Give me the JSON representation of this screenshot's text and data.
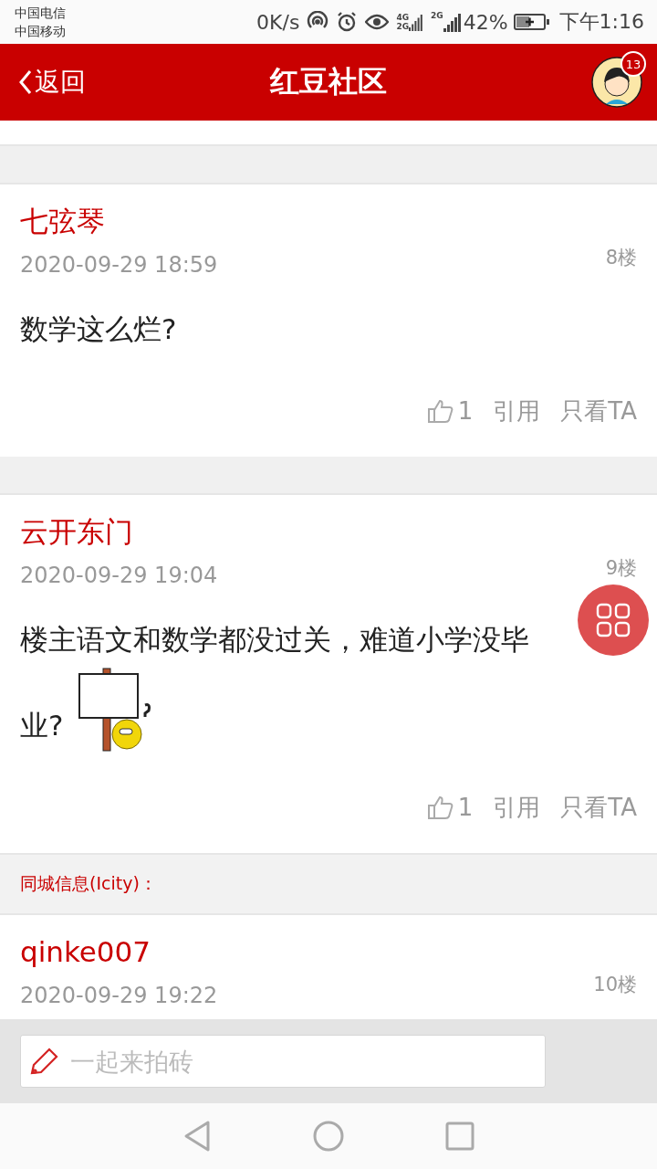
{
  "status_bar": {
    "carriers": [
      "中国电信",
      "中国移动"
    ],
    "speed": "0K/s",
    "network_1": "4G",
    "network_1b": "2G",
    "network_2": "2G",
    "battery": "42%",
    "time": "下午1:16"
  },
  "header": {
    "back": "返回",
    "title": "红豆社区",
    "badge": "13"
  },
  "posts": [
    {
      "author": "七弦琴",
      "time": "2020-09-29 18:59",
      "floor": "8楼",
      "content": "数学这么烂?",
      "sticker": false,
      "likes": "1",
      "quote": "引用",
      "only": "只看TA"
    },
    {
      "author": "云开东门",
      "time": "2020-09-29 19:04",
      "floor": "9楼",
      "content": "楼主语文和数学都没过关，难道小学没毕业?",
      "sticker": true,
      "likes": "1",
      "quote": "引用",
      "only": "只看TA"
    }
  ],
  "section": {
    "title": "同城信息(Icity)："
  },
  "partial_post": {
    "author": "qinke007",
    "time": "2020-09-29 19:22",
    "floor": "10楼"
  },
  "reply_bar": {
    "placeholder": "一起来拍砖"
  }
}
